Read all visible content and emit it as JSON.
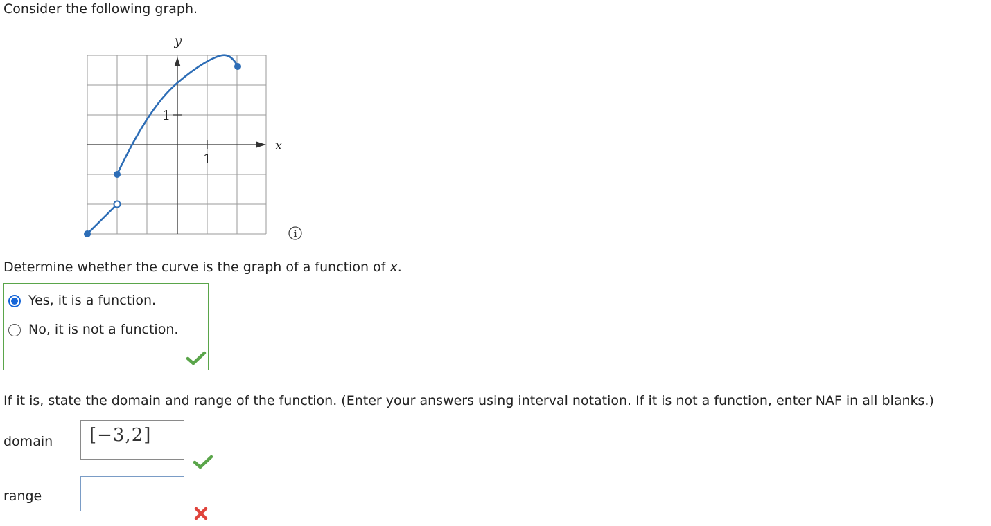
{
  "question": {
    "intro": "Consider the following graph.",
    "prompt_prefix": "Determine whether the curve is the graph of a function of ",
    "prompt_var": "x",
    "prompt_suffix": ".",
    "instructions": "If it is, state the domain and range of the function. (Enter your answers using interval notation. If it is not a function, enter NAF in all blanks.)"
  },
  "graph": {
    "y_label": "y",
    "x_label": "x",
    "x_tick": "1",
    "y_tick": "1",
    "info_symbol": "i",
    "curve_color": "#2d6db6",
    "grid_x_range": [
      -3,
      3
    ],
    "grid_y_range": [
      -3,
      3
    ],
    "points": {
      "left_closed": [
        -3,
        -3
      ],
      "left_open": [
        -2,
        -2
      ],
      "mid_closed": [
        -2,
        -1
      ],
      "right_closed": [
        2,
        2.7
      ]
    }
  },
  "choices": [
    {
      "label": "Yes, it is a function.",
      "selected": true
    },
    {
      "label": "No, it is not a function.",
      "selected": false
    }
  ],
  "answers": {
    "domain_label": "domain",
    "domain_value": "[−3,2]",
    "domain_status": "correct",
    "range_label": "range",
    "range_value": "",
    "range_status": "incorrect"
  },
  "colors": {
    "correct": "#5aa54a",
    "incorrect": "#e0443c",
    "selected_radio": "#1565d8"
  }
}
